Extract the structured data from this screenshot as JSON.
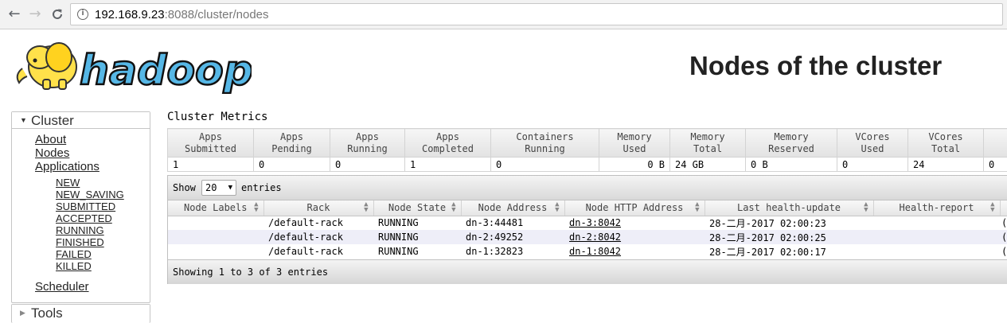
{
  "browser": {
    "back_icon": "←",
    "forward_icon": "→",
    "reload_icon": "C",
    "url_host": "192.168.9.23",
    "url_rest": ":8088/cluster/nodes"
  },
  "header": {
    "logo_text": "hadoop",
    "title": "Nodes of the cluster"
  },
  "nav": {
    "cluster_label": "Cluster",
    "about": "About",
    "nodes": "Nodes",
    "applications": "Applications",
    "states": [
      "NEW",
      "NEW_SAVING",
      "SUBMITTED",
      "ACCEPTED",
      "RUNNING",
      "FINISHED",
      "FAILED",
      "KILLED"
    ],
    "scheduler": "Scheduler",
    "tools_label": "Tools"
  },
  "metrics": {
    "title": "Cluster Metrics",
    "headers": [
      [
        "Apps",
        "Submitted"
      ],
      [
        "Apps",
        "Pending"
      ],
      [
        "Apps",
        "Running"
      ],
      [
        "Apps",
        "Completed"
      ],
      [
        "Containers",
        "Running"
      ],
      [
        "Memory",
        "Used"
      ],
      [
        "Memory",
        "Total"
      ],
      [
        "Memory",
        "Reserved"
      ],
      [
        "VCores",
        "Used"
      ],
      [
        "VCores",
        "Total"
      ],
      [
        "",
        ""
      ]
    ],
    "values": [
      "1",
      "0",
      "0",
      "1",
      "0",
      "0 B",
      "24 GB",
      "0 B",
      "0",
      "24",
      "0"
    ]
  },
  "nodes_table": {
    "show_label": "Show",
    "page_size": "20",
    "entries_label": "entries",
    "columns": [
      "Node Labels",
      "Rack",
      "Node State",
      "Node Address",
      "Node HTTP Address",
      "Last health-update",
      "Health-report",
      ""
    ],
    "rows": [
      {
        "labels": "",
        "rack": "/default-rack",
        "state": "RUNNING",
        "address": "dn-3:44481",
        "http": "dn-3:8042",
        "health_update": "28-二月-2017 02:00:23",
        "report": "",
        "extra": "("
      },
      {
        "labels": "",
        "rack": "/default-rack",
        "state": "RUNNING",
        "address": "dn-2:49252",
        "http": "dn-2:8042",
        "health_update": "28-二月-2017 02:00:25",
        "report": "",
        "extra": "("
      },
      {
        "labels": "",
        "rack": "/default-rack",
        "state": "RUNNING",
        "address": "dn-1:32823",
        "http": "dn-1:8042",
        "health_update": "28-二月-2017 02:00:17",
        "report": "",
        "extra": "("
      }
    ],
    "footer": "Showing 1 to 3 of 3 entries"
  },
  "colors": {
    "elephant_yellow": "#ffe14a",
    "logo_blue": "#56b7e6",
    "row_alt": "#eeeef8"
  }
}
